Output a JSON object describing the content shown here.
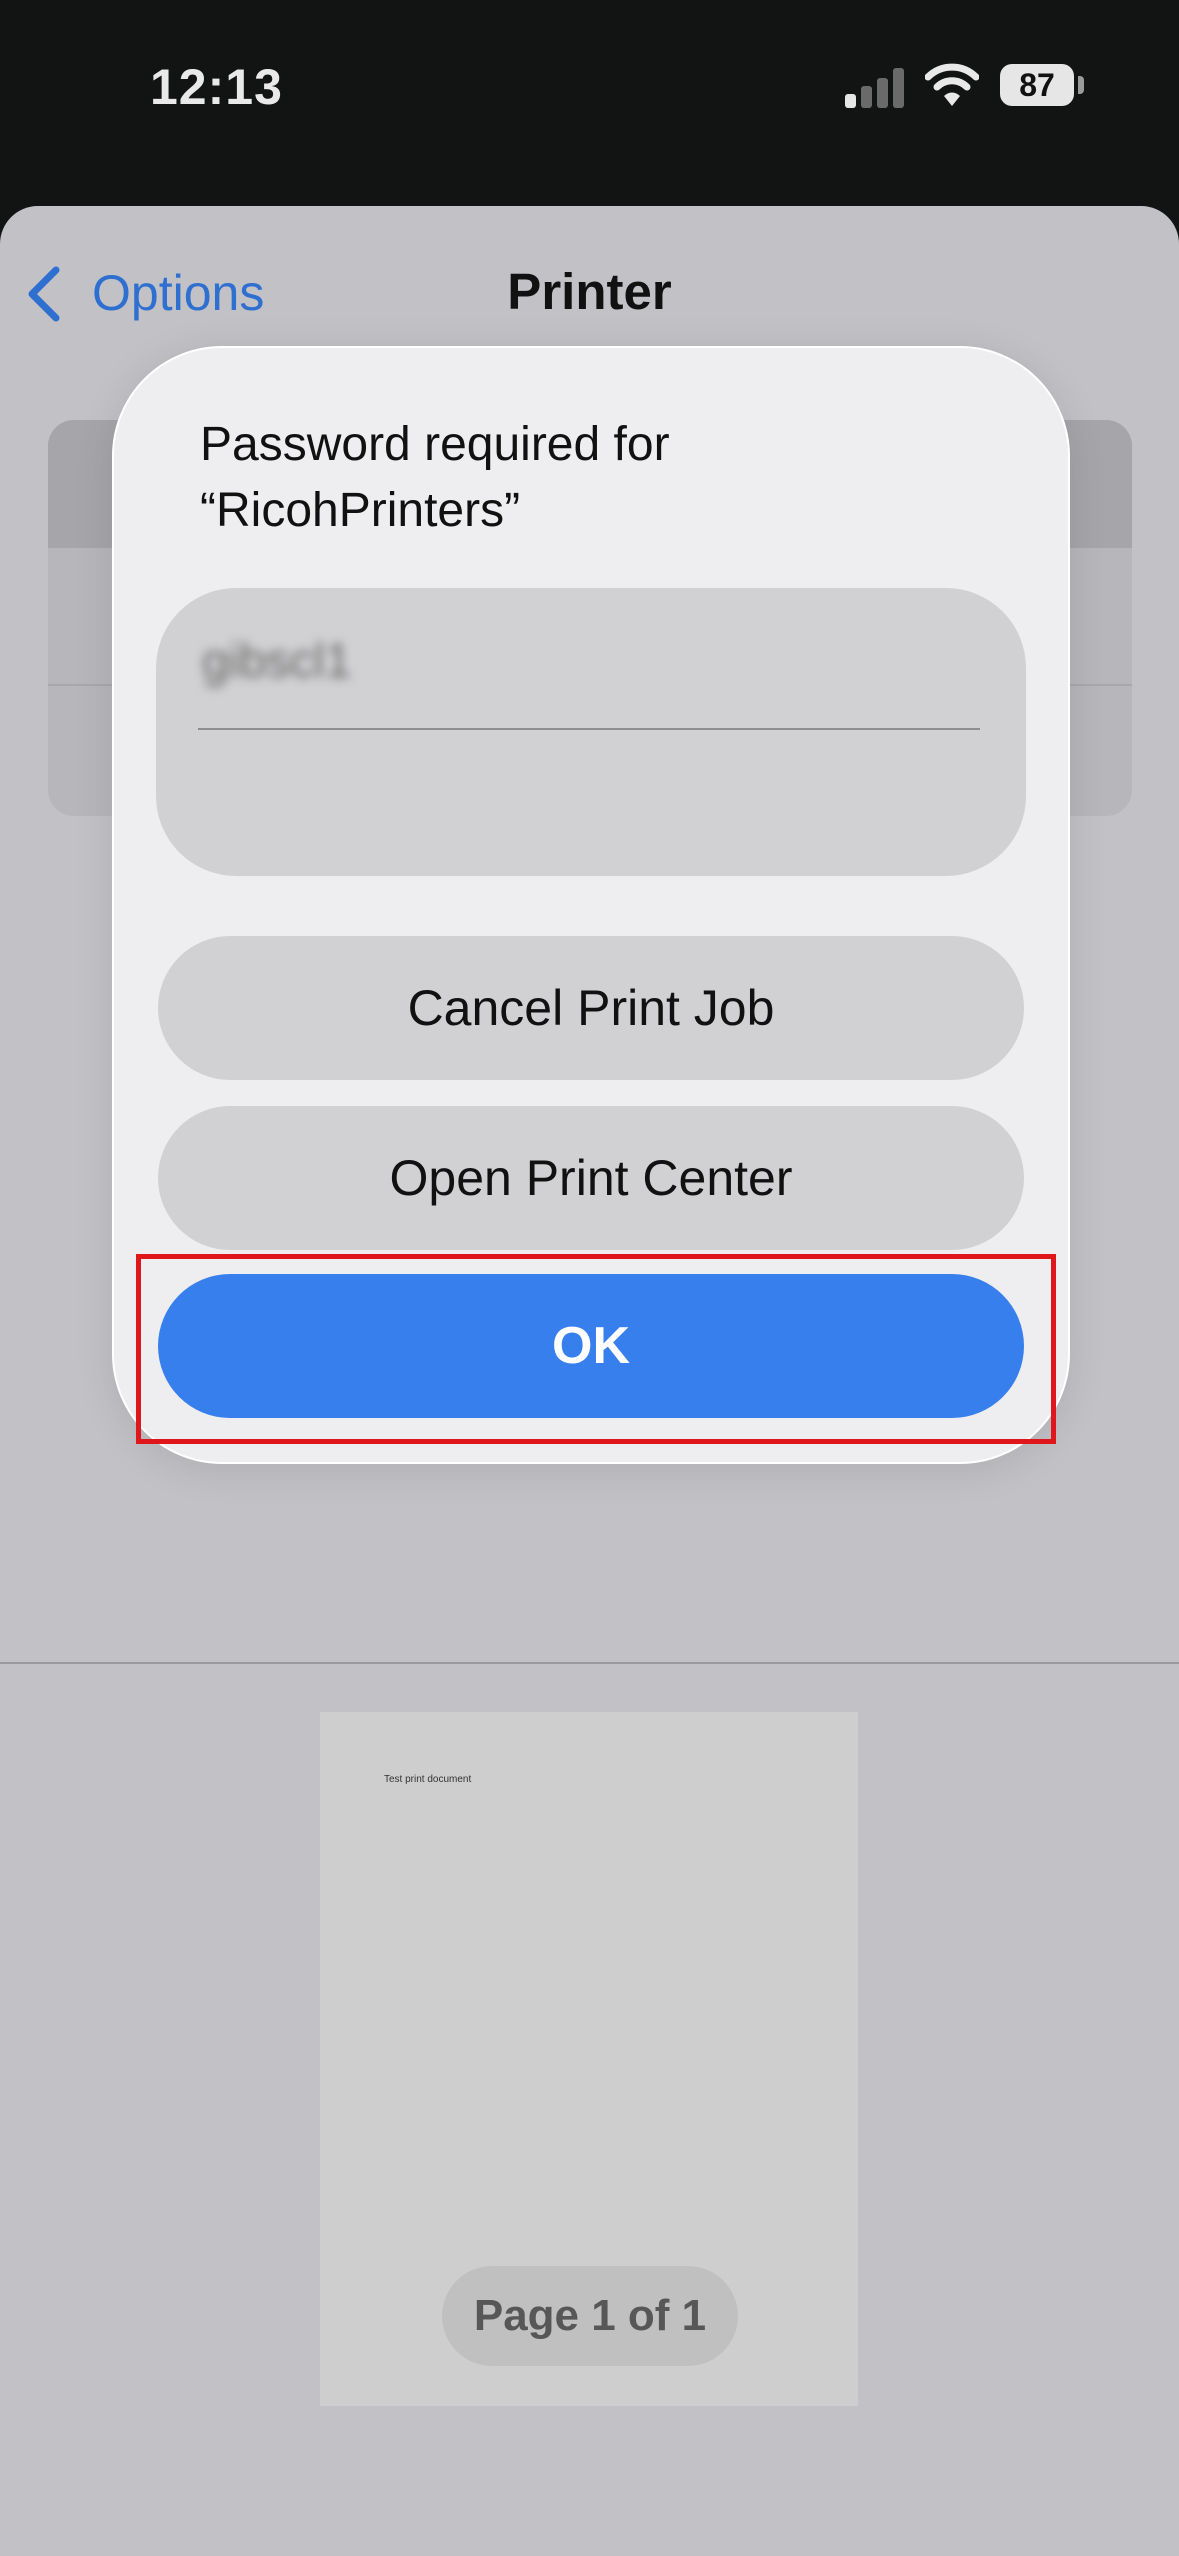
{
  "status_bar": {
    "time": "12:13",
    "battery_level": "87",
    "signal_icon": "cellular-signal-icon",
    "wifi_icon": "wifi-icon"
  },
  "nav": {
    "back_label": "Options",
    "title": "Printer"
  },
  "dialog": {
    "title": "Password required for “RicohPrinters”",
    "password_value": "gibscl1",
    "buttons": {
      "cancel": "Cancel Print Job",
      "open_center": "Open Print Center",
      "ok": "OK"
    }
  },
  "preview": {
    "document_text": "Test print document",
    "page_indicator": "Page 1 of 1"
  },
  "colors": {
    "accent": "#387fee",
    "highlight": "#e0161d",
    "link": "#2f6fd0"
  }
}
